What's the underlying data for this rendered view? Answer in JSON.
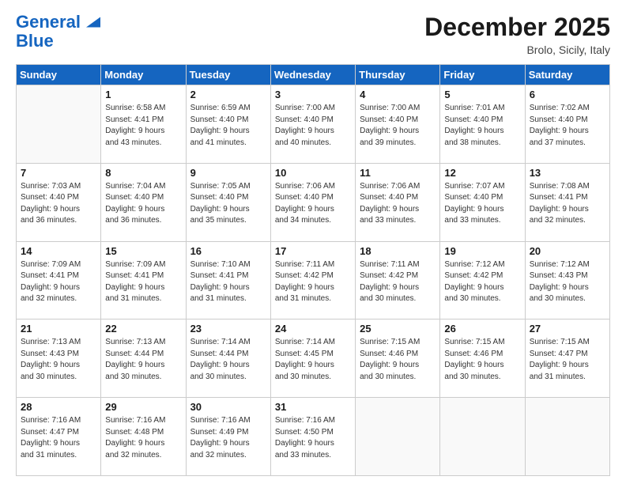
{
  "header": {
    "logo_line1": "General",
    "logo_line2": "Blue",
    "month": "December 2025",
    "location": "Brolo, Sicily, Italy"
  },
  "weekdays": [
    "Sunday",
    "Monday",
    "Tuesday",
    "Wednesday",
    "Thursday",
    "Friday",
    "Saturday"
  ],
  "weeks": [
    [
      {
        "day": "",
        "info": ""
      },
      {
        "day": "1",
        "info": "Sunrise: 6:58 AM\nSunset: 4:41 PM\nDaylight: 9 hours\nand 43 minutes."
      },
      {
        "day": "2",
        "info": "Sunrise: 6:59 AM\nSunset: 4:40 PM\nDaylight: 9 hours\nand 41 minutes."
      },
      {
        "day": "3",
        "info": "Sunrise: 7:00 AM\nSunset: 4:40 PM\nDaylight: 9 hours\nand 40 minutes."
      },
      {
        "day": "4",
        "info": "Sunrise: 7:00 AM\nSunset: 4:40 PM\nDaylight: 9 hours\nand 39 minutes."
      },
      {
        "day": "5",
        "info": "Sunrise: 7:01 AM\nSunset: 4:40 PM\nDaylight: 9 hours\nand 38 minutes."
      },
      {
        "day": "6",
        "info": "Sunrise: 7:02 AM\nSunset: 4:40 PM\nDaylight: 9 hours\nand 37 minutes."
      }
    ],
    [
      {
        "day": "7",
        "info": "Sunrise: 7:03 AM\nSunset: 4:40 PM\nDaylight: 9 hours\nand 36 minutes."
      },
      {
        "day": "8",
        "info": "Sunrise: 7:04 AM\nSunset: 4:40 PM\nDaylight: 9 hours\nand 36 minutes."
      },
      {
        "day": "9",
        "info": "Sunrise: 7:05 AM\nSunset: 4:40 PM\nDaylight: 9 hours\nand 35 minutes."
      },
      {
        "day": "10",
        "info": "Sunrise: 7:06 AM\nSunset: 4:40 PM\nDaylight: 9 hours\nand 34 minutes."
      },
      {
        "day": "11",
        "info": "Sunrise: 7:06 AM\nSunset: 4:40 PM\nDaylight: 9 hours\nand 33 minutes."
      },
      {
        "day": "12",
        "info": "Sunrise: 7:07 AM\nSunset: 4:40 PM\nDaylight: 9 hours\nand 33 minutes."
      },
      {
        "day": "13",
        "info": "Sunrise: 7:08 AM\nSunset: 4:41 PM\nDaylight: 9 hours\nand 32 minutes."
      }
    ],
    [
      {
        "day": "14",
        "info": "Sunrise: 7:09 AM\nSunset: 4:41 PM\nDaylight: 9 hours\nand 32 minutes."
      },
      {
        "day": "15",
        "info": "Sunrise: 7:09 AM\nSunset: 4:41 PM\nDaylight: 9 hours\nand 31 minutes."
      },
      {
        "day": "16",
        "info": "Sunrise: 7:10 AM\nSunset: 4:41 PM\nDaylight: 9 hours\nand 31 minutes."
      },
      {
        "day": "17",
        "info": "Sunrise: 7:11 AM\nSunset: 4:42 PM\nDaylight: 9 hours\nand 31 minutes."
      },
      {
        "day": "18",
        "info": "Sunrise: 7:11 AM\nSunset: 4:42 PM\nDaylight: 9 hours\nand 30 minutes."
      },
      {
        "day": "19",
        "info": "Sunrise: 7:12 AM\nSunset: 4:42 PM\nDaylight: 9 hours\nand 30 minutes."
      },
      {
        "day": "20",
        "info": "Sunrise: 7:12 AM\nSunset: 4:43 PM\nDaylight: 9 hours\nand 30 minutes."
      }
    ],
    [
      {
        "day": "21",
        "info": "Sunrise: 7:13 AM\nSunset: 4:43 PM\nDaylight: 9 hours\nand 30 minutes."
      },
      {
        "day": "22",
        "info": "Sunrise: 7:13 AM\nSunset: 4:44 PM\nDaylight: 9 hours\nand 30 minutes."
      },
      {
        "day": "23",
        "info": "Sunrise: 7:14 AM\nSunset: 4:44 PM\nDaylight: 9 hours\nand 30 minutes."
      },
      {
        "day": "24",
        "info": "Sunrise: 7:14 AM\nSunset: 4:45 PM\nDaylight: 9 hours\nand 30 minutes."
      },
      {
        "day": "25",
        "info": "Sunrise: 7:15 AM\nSunset: 4:46 PM\nDaylight: 9 hours\nand 30 minutes."
      },
      {
        "day": "26",
        "info": "Sunrise: 7:15 AM\nSunset: 4:46 PM\nDaylight: 9 hours\nand 30 minutes."
      },
      {
        "day": "27",
        "info": "Sunrise: 7:15 AM\nSunset: 4:47 PM\nDaylight: 9 hours\nand 31 minutes."
      }
    ],
    [
      {
        "day": "28",
        "info": "Sunrise: 7:16 AM\nSunset: 4:47 PM\nDaylight: 9 hours\nand 31 minutes."
      },
      {
        "day": "29",
        "info": "Sunrise: 7:16 AM\nSunset: 4:48 PM\nDaylight: 9 hours\nand 32 minutes."
      },
      {
        "day": "30",
        "info": "Sunrise: 7:16 AM\nSunset: 4:49 PM\nDaylight: 9 hours\nand 32 minutes."
      },
      {
        "day": "31",
        "info": "Sunrise: 7:16 AM\nSunset: 4:50 PM\nDaylight: 9 hours\nand 33 minutes."
      },
      {
        "day": "",
        "info": ""
      },
      {
        "day": "",
        "info": ""
      },
      {
        "day": "",
        "info": ""
      }
    ]
  ]
}
